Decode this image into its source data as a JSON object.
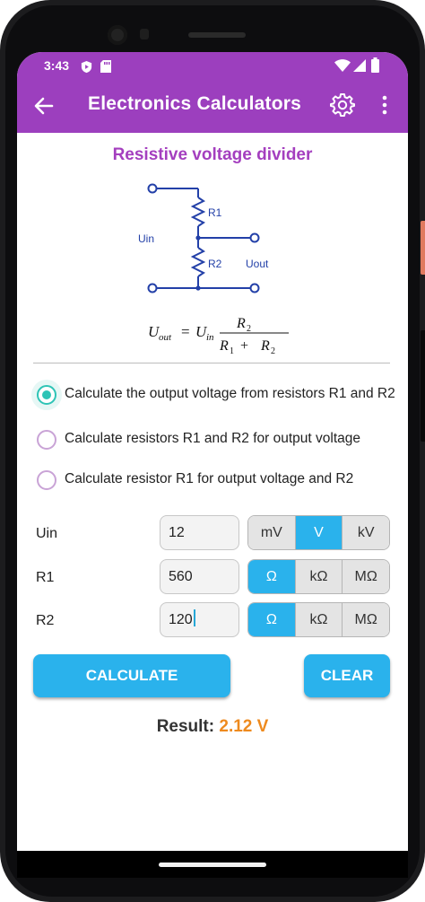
{
  "status": {
    "time": "3:43"
  },
  "app": {
    "title": "Electronics Calculators"
  },
  "section": {
    "title": "Resistive voltage divider",
    "circuit": {
      "r1": "R1",
      "r2": "R2",
      "uin": "Uin",
      "uout": "Uout"
    },
    "formula": {
      "lhs_var": "U",
      "lhs_sub": "out",
      "eq": "=",
      "rhs_var": "U",
      "rhs_sub": "in",
      "num": "R",
      "num_sub": "2",
      "den1": "R",
      "den1_sub": "1",
      "plus": "+",
      "den2": "R",
      "den2_sub": "2"
    }
  },
  "modes": [
    {
      "label": "Calculate the output voltage from resistors R1 and R2",
      "selected": true
    },
    {
      "label": "Calculate resistors R1 and R2 for output voltage",
      "selected": false
    },
    {
      "label": "Calculate resistor R1 for output voltage and R2",
      "selected": false
    }
  ],
  "fields": {
    "uin": {
      "label": "Uin",
      "value": "12",
      "units": [
        "mV",
        "V",
        "kV"
      ],
      "selected": "V"
    },
    "r1": {
      "label": "R1",
      "value": "560",
      "units": [
        "Ω",
        "kΩ",
        "MΩ"
      ],
      "selected": "Ω"
    },
    "r2": {
      "label": "R2",
      "value": "120",
      "units": [
        "Ω",
        "kΩ",
        "MΩ"
      ],
      "selected": "Ω"
    }
  },
  "actions": {
    "calculate": "CALCULATE",
    "clear": "CLEAR"
  },
  "result": {
    "label": "Result:",
    "value": "2.12 V"
  },
  "colors": {
    "appbar": "#9c3fbe",
    "accent_title": "#a43fbf",
    "button": "#2ab2ec",
    "radio_selected": "#2ec4b6",
    "result_value": "#ee8a1e",
    "circuit": "#2340a8"
  },
  "icons": {
    "back": "arrow-left-icon",
    "settings": "gear-icon",
    "more": "more-vert-icon"
  }
}
